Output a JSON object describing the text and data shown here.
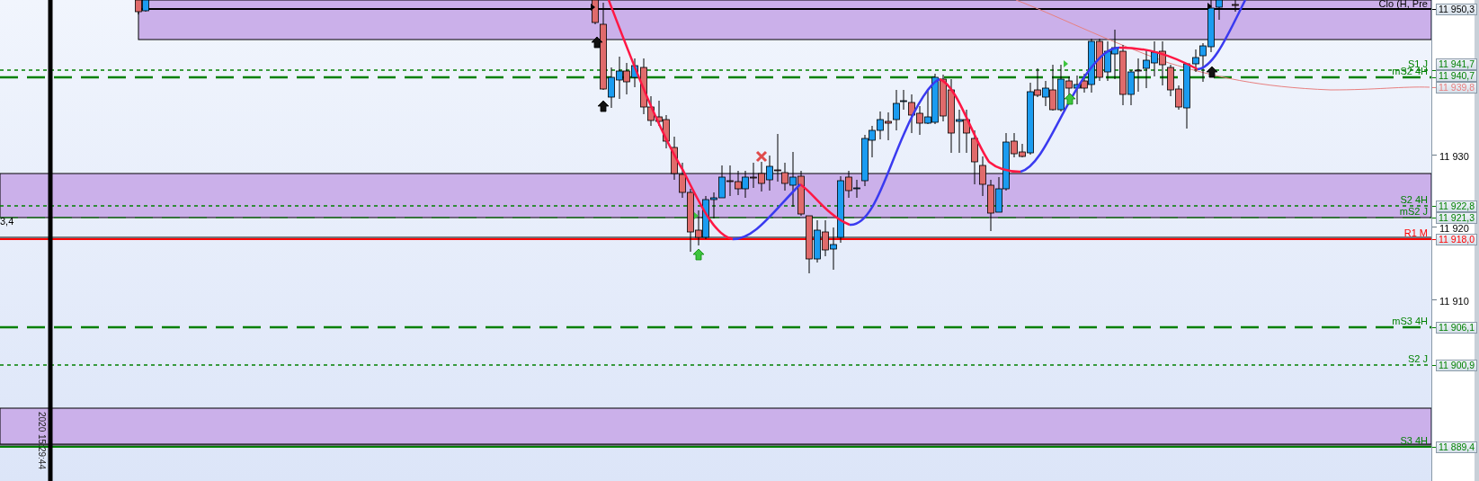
{
  "chart": {
    "left_value": "3,4",
    "timestamp": "2020 15:29:44",
    "axis_ticks": [
      "11 930",
      "11 920",
      "11 910"
    ],
    "levels": [
      {
        "label": "Clo (H, Pre",
        "price": "11 950,3",
        "kind": "solid",
        "color": "#000000"
      },
      {
        "label": "S1 J",
        "price": "11 941,7",
        "kind": "dotted",
        "color": "#008000"
      },
      {
        "label": "mS2 4H",
        "price": "11 940,7",
        "kind": "dashed",
        "color": "#008000"
      },
      {
        "price": "11 939,8",
        "kind": "curve",
        "color": "#e88080"
      },
      {
        "label": "S2 4H",
        "price": "11 922,8",
        "kind": "dotted",
        "color": "#008000"
      },
      {
        "label": "mS2 J",
        "price": "11 921,3",
        "kind": "dash-thin",
        "color": "#008000"
      },
      {
        "label": "R1 M",
        "price": "11 918,0",
        "kind": "solid",
        "color": "#ff0000"
      },
      {
        "label": "mS3 4H",
        "price": "11 906,1",
        "kind": "dashed",
        "color": "#008000"
      },
      {
        "label": "S2 J",
        "price": "11 900,9",
        "kind": "dotted",
        "color": "#008000"
      },
      {
        "label": "S3 4H",
        "price": "11 889,4",
        "kind": "solid",
        "color": "#008000"
      }
    ]
  }
}
